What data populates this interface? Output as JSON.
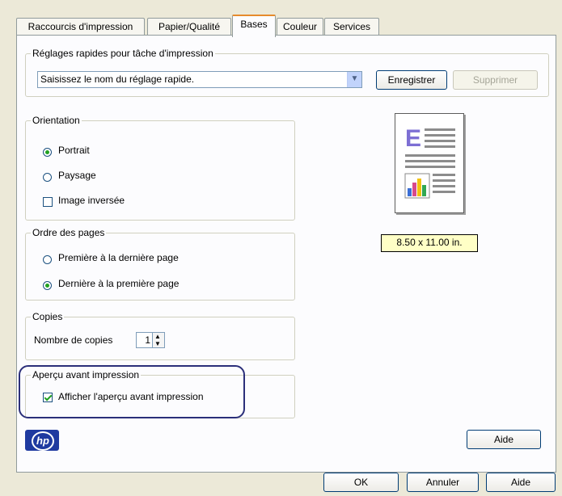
{
  "tabs": [
    {
      "label": "Raccourcis d'impression"
    },
    {
      "label": "Papier/Qualité"
    },
    {
      "label": "Bases"
    },
    {
      "label": "Couleur"
    },
    {
      "label": "Services"
    }
  ],
  "quick_settings": {
    "title": "Réglages rapides pour tâche d'impression",
    "combo_value": "Saisissez le nom du réglage rapide.",
    "save_label": "Enregistrer",
    "delete_label": "Supprimer"
  },
  "orientation": {
    "title": "Orientation",
    "portrait": "Portrait",
    "landscape": "Paysage",
    "mirror": "Image inversée"
  },
  "page_order": {
    "title": "Ordre des pages",
    "first_to_last": "Première à la dernière page",
    "last_to_first": "Dernière à la première page"
  },
  "copies": {
    "title": "Copies",
    "label": "Nombre de copies",
    "value": "1"
  },
  "preview": {
    "title": "Aperçu avant impression",
    "show_label": "Afficher l'aperçu avant impression"
  },
  "paper_size": "8.50 x 11.00 in.",
  "logo_text": "hp",
  "buttons": {
    "help_panel": "Aide",
    "ok": "OK",
    "cancel": "Annuler",
    "help": "Aide"
  }
}
